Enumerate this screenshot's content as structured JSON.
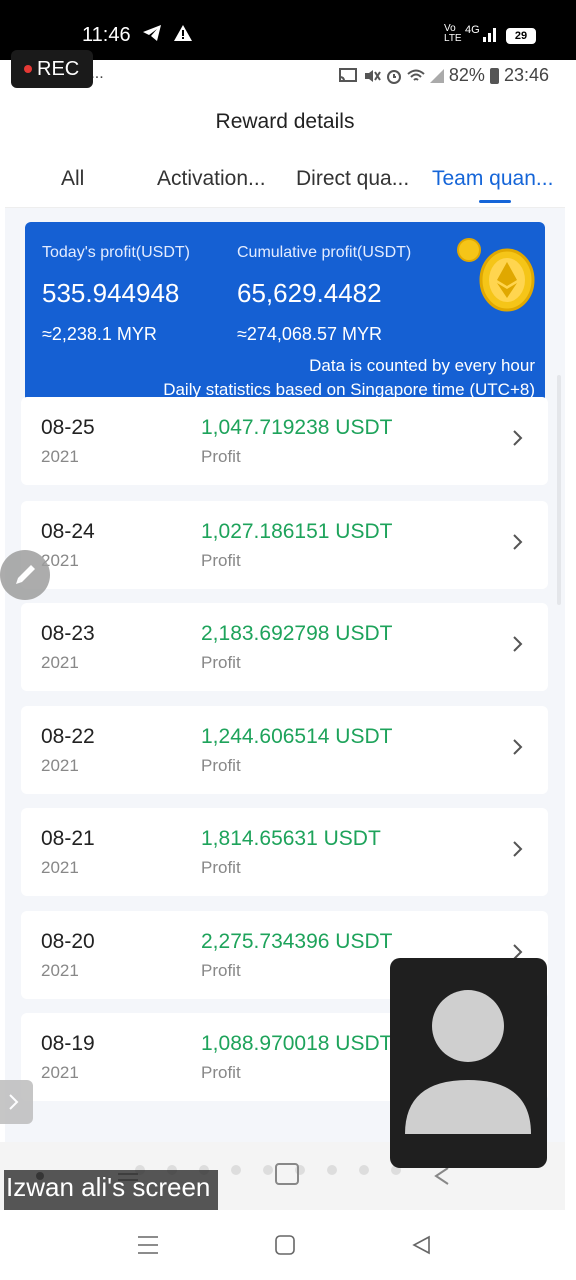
{
  "outer_status": {
    "time": "11:46",
    "network": "4G",
    "battery": "29",
    "icons_left": [
      "telegram-icon",
      "warning-icon"
    ],
    "icons_right": [
      "volte-icon",
      "signal-icon"
    ]
  },
  "inner_status": {
    "icons_left": [
      "app-icon",
      "cloud-icon",
      "facebook-icon",
      "more-icon"
    ],
    "battery_percent": "82%",
    "time": "23:46"
  },
  "rec_badge": "REC",
  "header": {
    "title": "Reward details"
  },
  "tabs": [
    {
      "label": "All",
      "active": false
    },
    {
      "label": "Activation...",
      "active": false
    },
    {
      "label": "Direct qua...",
      "active": false
    },
    {
      "label": "Team quan...",
      "active": true
    }
  ],
  "profit_card": {
    "today_label": "Today's profit(USDT)",
    "today_value": "535.944948",
    "today_myr": "≈2,238.1 MYR",
    "cumulative_label": "Cumulative profit(USDT)",
    "cumulative_value": "65,629.4482",
    "cumulative_myr": "≈274,068.57 MYR",
    "note_line1": "Data is counted by every hour",
    "note_line2": "Daily statistics based on Singapore time (UTC+8)",
    "colors": {
      "card": "#1560d3",
      "coin": "#f5c518"
    }
  },
  "records": [
    {
      "date": "08-25",
      "year": "2021",
      "amount": "1,047.719238 USDT",
      "label": "Profit"
    },
    {
      "date": "08-24",
      "year": "2021",
      "amount": "1,027.186151 USDT",
      "label": "Profit"
    },
    {
      "date": "08-23",
      "year": "2021",
      "amount": "2,183.692798 USDT",
      "label": "Profit"
    },
    {
      "date": "08-22",
      "year": "2021",
      "amount": "1,244.606514 USDT",
      "label": "Profit"
    },
    {
      "date": "08-21",
      "year": "2021",
      "amount": "1,814.65631 USDT",
      "label": "Profit"
    },
    {
      "date": "08-20",
      "year": "2021",
      "amount": "2,275.734396 USDT",
      "label": "Profit"
    },
    {
      "date": "08-19",
      "year": "2021",
      "amount": "1,088.970018 USDT",
      "label": "Profit"
    }
  ],
  "screen_share_label": "Izwan ali's screen",
  "accent_colors": {
    "primary": "#1565d8",
    "amount": "#1ea35b"
  }
}
